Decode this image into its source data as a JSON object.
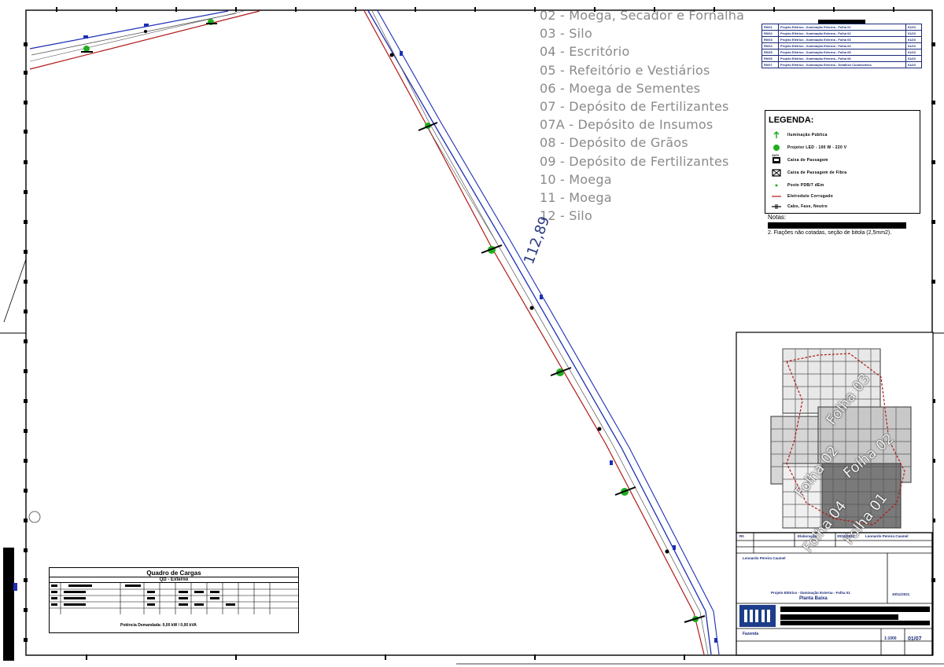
{
  "legend_items": [
    "02 - Moega, Secador e Fornalha",
    "03 - Silo",
    "04 - Escritório",
    "05 - Refeitório e Vestiários",
    "06 - Moega de Sementes",
    "07 - Depósito de Fertilizantes",
    "07A - Depósito de Insumos",
    "08 - Depósito de Grãos",
    "09 - Depósito de Fertilizantes",
    "10 - Moega",
    "11 - Moega",
    "12 - Silo"
  ],
  "distance_label": "112,89",
  "symbol_legend": {
    "title": "LEGENDA:",
    "unit": "112V",
    "rows": [
      {
        "icon": "arrow-symbol-icon",
        "text": "Iluminação Pública"
      },
      {
        "icon": "tree-symbol-icon",
        "text": "Projetor LED - 100 W - 220 V"
      },
      {
        "icon": "box-symbol-icon",
        "text": "Caixa de Passagem"
      },
      {
        "icon": "x-box-symbol-icon",
        "text": "Caixa de Passagem de Fibra"
      },
      {
        "icon": "dot-symbol-icon",
        "text": "Poste PDB/7 dEm"
      },
      {
        "icon": "red-line-symbol-icon",
        "text": "Eletroduto Corrugado"
      },
      {
        "icon": "cable-symbol-icon",
        "text": "Cabo, Fase, Neutro"
      }
    ]
  },
  "notes": {
    "label": "Notas:",
    "note2": "2. Fiações não cotadas, seção de bitola (2,5mm2)."
  },
  "revision_table": {
    "rows": [
      [
        "R0/01",
        "Projeto Elétrico - Iluminação Externa - Folha 01",
        "01/23"
      ],
      [
        "R0/02",
        "Projeto Elétrico - Iluminação Externa - Folha 02",
        "01/23"
      ],
      [
        "R0/03",
        "Projeto Elétrico - Iluminação Externa - Folha 03",
        "01/23"
      ],
      [
        "R0/04",
        "Projeto Elétrico - Iluminação Externa - Folha 04",
        "01/23"
      ],
      [
        "R0/05",
        "Projeto Elétrico - Iluminação Externa - Folha 05",
        "01/23"
      ],
      [
        "R0/06",
        "Projeto Elétrico - Iluminação Externa - Folha 06",
        "01/23"
      ],
      [
        "R0/07",
        "Projeto Elétrico - Iluminação Externa - Detalhes Construtivos",
        "01/23"
      ]
    ]
  },
  "key_map": {
    "sheets": [
      "Folha 03",
      "Folha 02",
      "Folha 02",
      "Folha 04",
      "Folha 01"
    ]
  },
  "loads_table": {
    "title": "Quadro de Cargas",
    "subtitle": "QD - Externo",
    "bottom": "Potência Demandada: 0,00 kW / 0,00 kVA"
  },
  "title_block": {
    "rev_code": "R0",
    "rev_desc": "Elaboração",
    "rev_date": "30/11/2021",
    "drawn_by": "Leonardo Pereira Caumel",
    "checked_by": "Leonardo Pereira Caumel",
    "project_desc_1": "Projeto Elétrico - Iluminação Externa - Folha 01",
    "project_desc_2": "Planta Baixa",
    "date": "30/11/2021",
    "client": "Fazenda",
    "sheet": "01/07",
    "scale": "1:1000"
  },
  "colors": {
    "route_blue": "#1d2fb5",
    "route_red": "#b01818",
    "fixture_green": "#1fae1f",
    "legend_gray": "#8a8a8a"
  }
}
